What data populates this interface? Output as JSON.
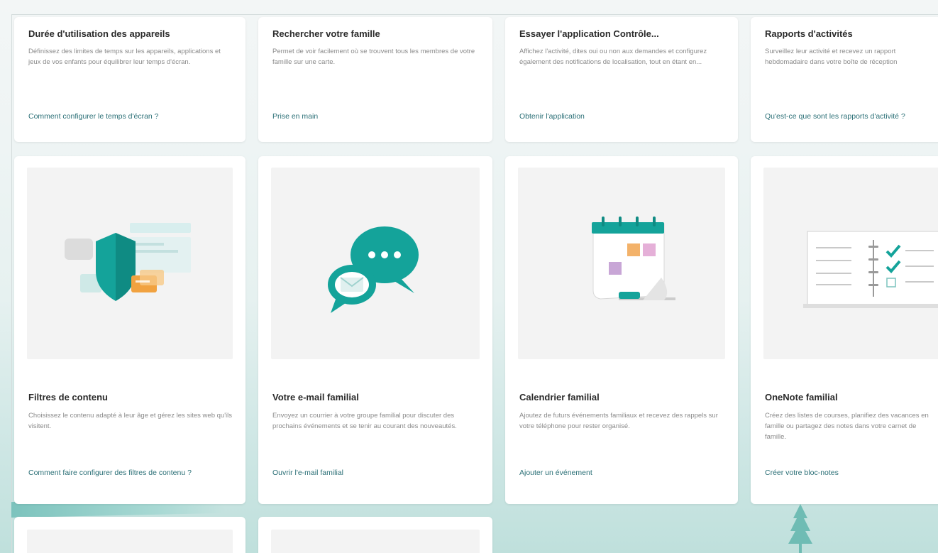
{
  "top_cards": [
    {
      "title": "Durée d'utilisation des appareils",
      "description": "Définissez des limites de temps sur les appareils, applications et jeux de vos enfants pour équilibrer leur temps d'écran.",
      "link": "Comment configurer le temps d'écran ?"
    },
    {
      "title": "Rechercher votre famille",
      "description": "Permet de voir facilement où se trouvent tous les membres de votre famille sur une carte.",
      "link": "Prise en main"
    },
    {
      "title": "Essayer l'application Contrôle...",
      "description": "Affichez l'activité, dites oui ou non aux demandes et configurez également des notifications de localisation, tout en étant en...",
      "link": "Obtenir l'application"
    },
    {
      "title": "Rapports d'activités",
      "description": "Surveillez leur activité et recevez un rapport hebdomadaire dans votre boîte de réception",
      "link": "Qu'est-ce que sont les rapports d'activité ?"
    }
  ],
  "feature_cards": [
    {
      "title": "Filtres de contenu",
      "description": "Choisissez le contenu adapté à leur âge et gérez les sites web qu'ils visitent.",
      "link": "Comment faire configurer des filtres de contenu ?",
      "icon": "shield-icon"
    },
    {
      "title": "Votre e-mail familial",
      "description": "Envoyez un courrier à votre groupe familial pour discuter des prochains événements et se tenir au courant des nouveautés.",
      "link": "Ouvrir l'e-mail familial",
      "icon": "chat-bubbles-icon"
    },
    {
      "title": "Calendrier familial",
      "description": "Ajoutez de futurs événements familiaux et recevez des rappels sur votre téléphone pour rester organisé.",
      "link": "Ajouter un événement",
      "icon": "calendar-icon"
    },
    {
      "title": "OneNote familial",
      "description": "Créez des listes de courses, planifiez des vacances en famille ou partagez des notes dans votre carnet de famille.",
      "link": "Créer votre bloc-notes",
      "icon": "checklist-icon"
    }
  ],
  "colors": {
    "accent": "#14a39a",
    "link": "#2a6f76",
    "orange": "#f1a240",
    "pink": "#e5b0d8",
    "purple": "#c8a6d6"
  }
}
